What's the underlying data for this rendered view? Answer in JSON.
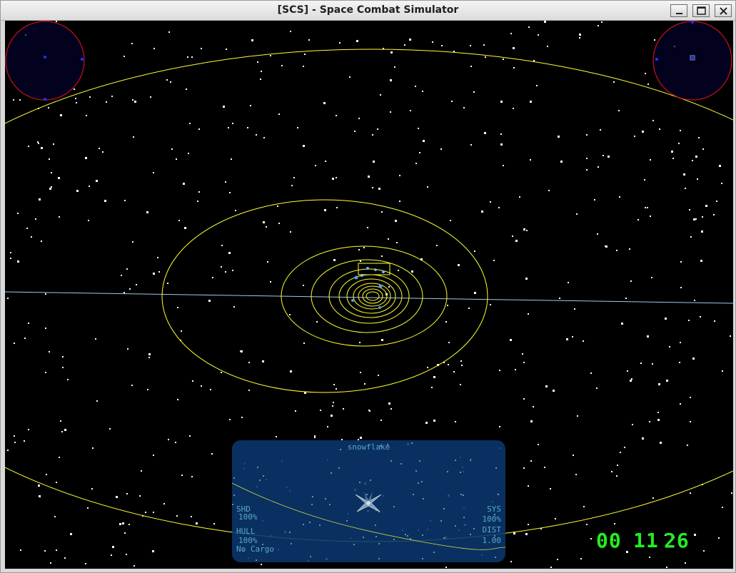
{
  "window": {
    "title": "[SCS] - Space Combat Simulator",
    "buttons": [
      "minimize",
      "maximize",
      "close"
    ]
  },
  "colors": {
    "space": "#000000",
    "stars": "#ffffff",
    "orbit": "#ffff33",
    "horizon": "#9ecbe8",
    "radar_border": "#cc1111",
    "radar_fill": "#02021e",
    "panel_bg": "#0a376e",
    "panel_text": "#5aa8c8",
    "clock": "#22ee22"
  },
  "radars": [
    {
      "name": "left-radar",
      "icon": "radar-scope"
    },
    {
      "name": "right-radar",
      "icon": "radar-scope"
    }
  ],
  "scene": {
    "target_marker": "selected-planet-bracket",
    "orbits": "system-orbit-rings",
    "horizon": "ecliptic-line"
  },
  "target": {
    "name": "snowflake",
    "shd_label": "SHD",
    "shd_value": "100%",
    "hull_label": "HULL",
    "hull_value": "100%",
    "cargo": "No Cargo",
    "sys_label": "SYS",
    "sys_value": "100%",
    "dist_label": "DIST",
    "dist_value": "1.00",
    "ship_icon": "fighter-ship-icon"
  },
  "clock": {
    "hours": "00",
    "minutes": "11",
    "seconds": "26"
  }
}
